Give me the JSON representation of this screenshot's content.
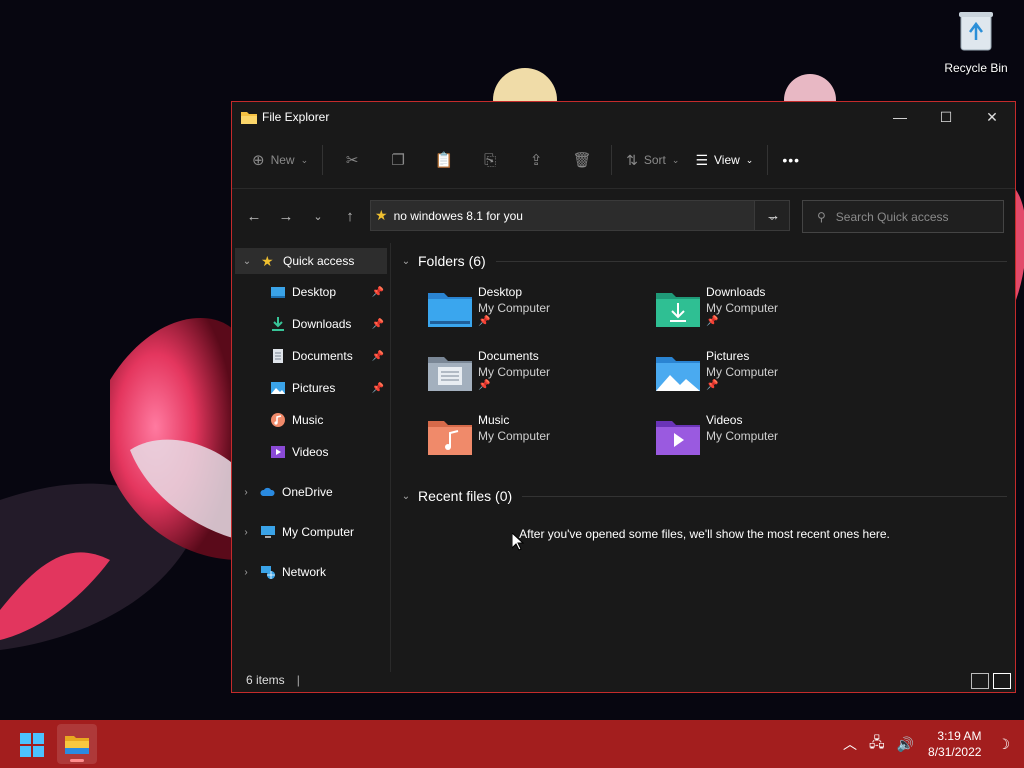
{
  "desktop": {
    "recycle_bin_label": "Recycle Bin"
  },
  "window": {
    "title": "File Explorer",
    "controls": {
      "minimize": "—",
      "maximize": "☐",
      "close": "✕"
    }
  },
  "toolbar": {
    "new_label": "New",
    "sort_label": "Sort",
    "view_label": "View",
    "more_label": "•••"
  },
  "address": {
    "value": "no windowes 8.1 for you",
    "search_placeholder": "Search Quick access"
  },
  "sidebar": {
    "quick_access": "Quick access",
    "pinned": [
      {
        "label": "Desktop",
        "pinned": true
      },
      {
        "label": "Downloads",
        "pinned": true
      },
      {
        "label": "Documents",
        "pinned": true
      },
      {
        "label": "Pictures",
        "pinned": true
      },
      {
        "label": "Music",
        "pinned": false
      },
      {
        "label": "Videos",
        "pinned": false
      }
    ],
    "onedrive": "OneDrive",
    "my_computer": "My Computer",
    "network": "Network"
  },
  "content": {
    "folders_heading": "Folders (6)",
    "folders": [
      {
        "name": "Desktop",
        "location": "My Computer",
        "pinned": true
      },
      {
        "name": "Downloads",
        "location": "My Computer",
        "pinned": true
      },
      {
        "name": "Documents",
        "location": "My Computer",
        "pinned": true
      },
      {
        "name": "Pictures",
        "location": "My Computer",
        "pinned": true
      },
      {
        "name": "Music",
        "location": "My Computer",
        "pinned": false
      },
      {
        "name": "Videos",
        "location": "My Computer",
        "pinned": false
      }
    ],
    "recent_heading": "Recent files (0)",
    "recent_empty": "After you've opened some files, we'll show the most recent ones here."
  },
  "statusbar": {
    "items_count": "6 items",
    "separator": "|"
  },
  "taskbar": {
    "time": "3:19 AM",
    "date": "8/31/2022"
  },
  "colors": {
    "accent": "#c42b2b",
    "taskbar": "#a31e1e",
    "window_bg": "#191919"
  }
}
